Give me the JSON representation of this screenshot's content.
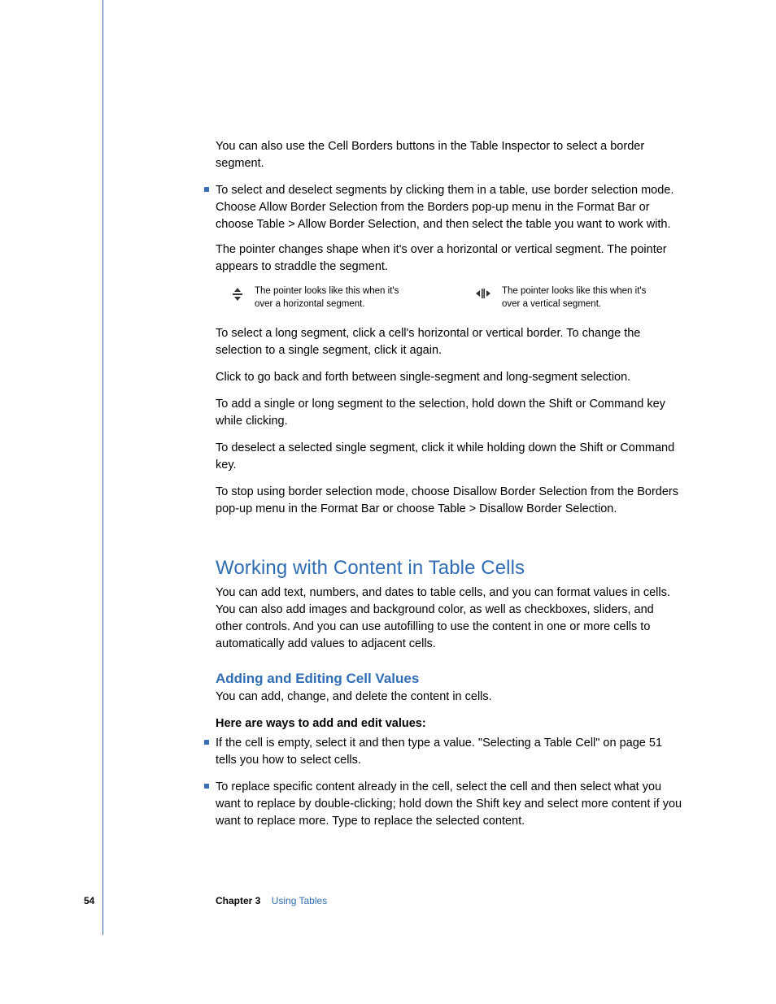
{
  "paragraphs": {
    "p1": "You can also use the Cell Borders buttons in the Table Inspector to select a border segment.",
    "b1": "To select and deselect segments by clicking them in a table, use border selection mode. Choose Allow Border Selection from the Borders pop-up menu in the Format Bar or choose Table > Allow Border Selection, and then select the table you want to work with.",
    "p2": "The pointer changes shape when it's over a horizontal or vertical segment. The pointer appears to straddle the segment.",
    "p3": "To select a long segment, click a cell's horizontal or vertical border. To change the selection to a single segment, click it again.",
    "p4": "Click to go back and forth between single-segment and long-segment selection.",
    "p5": "To add a single or long segment to the selection, hold down the Shift or Command key while clicking.",
    "p6": "To deselect a selected single segment, click it while holding down the Shift or Command key.",
    "p7": "To stop using border selection mode, choose Disallow Border Selection from the Borders pop-up menu in the Format Bar or choose Table > Disallow Border Selection."
  },
  "callouts": {
    "horizontal": "The pointer looks like this when it's over a horizontal segment.",
    "vertical": "The pointer looks like this when it's over a vertical segment."
  },
  "section": {
    "title": "Working with Content in Table Cells",
    "intro": "You can add text, numbers, and dates to table cells, and you can format values in cells. You can also add images and background color, as well as checkboxes, sliders, and other controls. And you can use autofilling to use the content in one or more cells to automatically add values to adjacent cells."
  },
  "subsection": {
    "title": "Adding and Editing Cell Values",
    "intro": "You can add, change, and delete the content in cells.",
    "lead": "Here are ways to add and edit values:",
    "b1": "If the cell is empty, select it and then type a value. \"Selecting a Table Cell\" on page 51 tells you how to select cells.",
    "b2": "To replace specific content already in the cell, select the cell and then select what you want to replace by double-clicking; hold down the Shift key and select more content if you want to replace more. Type to replace the selected content."
  },
  "footer": {
    "page": "54",
    "chapter_label": "Chapter 3",
    "chapter_title": "Using Tables"
  }
}
